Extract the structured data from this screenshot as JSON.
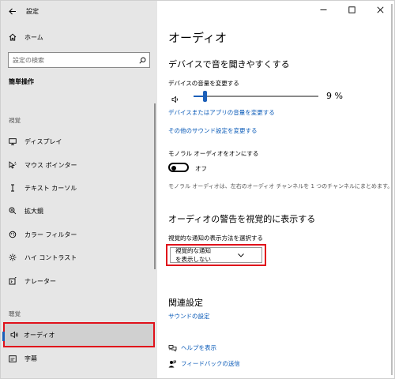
{
  "app": {
    "title": "設定"
  },
  "sidebar": {
    "home": "ホーム",
    "search_placeholder": "設定の検索",
    "group": "簡単操作",
    "section_vision": "視覚",
    "section_hearing": "聴覚",
    "items": [
      {
        "label": "ディスプレイ",
        "icon": "display-icon"
      },
      {
        "label": "マウス ポインター",
        "icon": "mouse-pointer-icon"
      },
      {
        "label": "テキスト カーソル",
        "icon": "text-cursor-icon"
      },
      {
        "label": "拡大鏡",
        "icon": "magnifier-icon"
      },
      {
        "label": "カラー フィルター",
        "icon": "color-filter-icon"
      },
      {
        "label": "ハイ コントラスト",
        "icon": "high-contrast-icon"
      },
      {
        "label": "ナレーター",
        "icon": "narrator-icon"
      },
      {
        "label": "オーディオ",
        "icon": "speaker-icon",
        "selected": true
      },
      {
        "label": "字幕",
        "icon": "captions-icon"
      }
    ]
  },
  "main": {
    "title": "オーディオ",
    "section1": {
      "heading": "デバイスで音を聞きやすくする",
      "volume_label": "デバイスの音量を変更する",
      "volume_value": 9,
      "volume_display": "9 %",
      "link_app_volume": "デバイスまたはアプリの音量を変更する",
      "link_other_sound": "その他のサウンド設定を変更する",
      "mono_label": "モノラル オーディオをオンにする",
      "mono_state": "オフ",
      "mono_desc": "モノラル オーディオは、左右のオーディオ チャンネルを 1 つのチャンネルにまとめます。"
    },
    "section2": {
      "heading": "オーディオの警告を視覚的に表示する",
      "select_label": "視覚的な通知の表示方法を選択する",
      "select_value": "視覚的な通知を表示しない"
    },
    "related": {
      "heading": "関連設定",
      "link_sound": "サウンドの設定"
    },
    "help": "ヘルプを表示",
    "feedback": "フィードバックの送信"
  },
  "colors": {
    "accent": "#1c5fb8",
    "highlight": "#e0111b",
    "link": "#0b5bb8"
  }
}
